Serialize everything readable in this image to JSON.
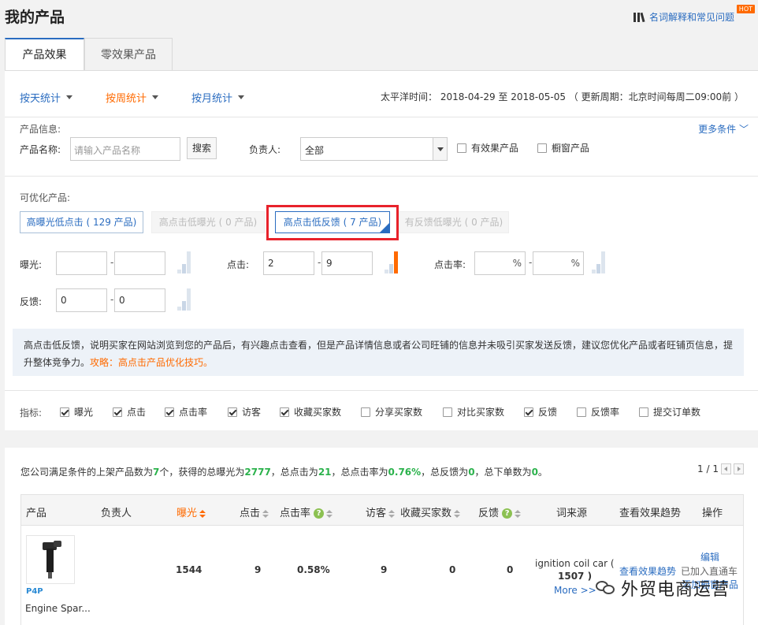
{
  "page_title": "我的产品",
  "help_link": "名词解释和常见问题",
  "hot_badge": "HOT",
  "tabs": [
    "产品效果",
    "零效果产品"
  ],
  "stat_nav": [
    {
      "label": "按天统计",
      "color": "#2a6cc0"
    },
    {
      "label": "按周统计",
      "color": "#ff6a00"
    },
    {
      "label": "按月统计",
      "color": "#2a6cc0"
    }
  ],
  "date_range": "太平洋时间： 2018-04-29 至 2018-05-05 （ 更新周期：北京时间每周二09:00前 ）",
  "filter": {
    "section_label": "产品信息:",
    "name_label": "产品名称:",
    "name_placeholder": "请输入产品名称",
    "search_button": "搜索",
    "owner_label": "负责人:",
    "owner_value": "全部",
    "effective_checkbox": "有效果产品",
    "window_checkbox": "橱窗产品",
    "more_conditions": "更多条件"
  },
  "optimizable": {
    "label": "可优化产品:",
    "buttons": [
      "高曝光低点击 ( 129 产品)",
      "高点击低曝光 ( 0 产品)",
      "高点击低反馈 ( 7 产品)",
      "有反馈低曝光 ( 0 产品)"
    ]
  },
  "ranges": {
    "exposure_label": "曝光:",
    "exposure_min": "",
    "exposure_max": "",
    "click_label": "点击:",
    "click_min": "2",
    "click_max": "9",
    "ctr_label": "点击率:",
    "ctr_min": "",
    "ctr_max": "",
    "pct": "%",
    "feedback_label": "反馈:",
    "feedback_min": "0",
    "feedback_max": "0",
    "dash": "-"
  },
  "info": {
    "text": "高点击低反馈，说明买家在网站浏览到您的产品后，有兴趣点击查看，但是产品详情信息或者公司旺铺的信息并未吸引买家发送反馈，建议您优化产品或者旺铺页信息，提升整体竞争力。",
    "link": "攻略：高点击产品优化技巧。"
  },
  "metrics": {
    "label": "指标:",
    "items": [
      {
        "label": "曝光",
        "checked": true
      },
      {
        "label": "点击",
        "checked": true
      },
      {
        "label": "点击率",
        "checked": true
      },
      {
        "label": "访客",
        "checked": true
      },
      {
        "label": "收藏买家数",
        "checked": true
      },
      {
        "label": "分享买家数",
        "checked": false
      },
      {
        "label": "对比买家数",
        "checked": false
      },
      {
        "label": "反馈",
        "checked": true
      },
      {
        "label": "反馈率",
        "checked": false
      },
      {
        "label": "提交订单数",
        "checked": false
      }
    ]
  },
  "summary": {
    "p1": "您公司满足条件的上架产品数为",
    "products": "7",
    "p2": "个，获得的总曝光为",
    "exposure": "2777",
    "p3": "，总点击为",
    "clicks": "21",
    "p4": "，总点击率为",
    "ctr": "0.76%",
    "p5": "，总反馈为",
    "feedback": "0",
    "p6": "，总下单数为",
    "orders": "0",
    "p7": "。"
  },
  "pager": "1 / 1",
  "table": {
    "headers": [
      "产品",
      "负责人",
      "曝光",
      "点击",
      "点击率",
      "访客",
      "收藏买家数",
      "反馈",
      "词来源",
      "查看效果趋势",
      "操作"
    ],
    "row": {
      "p4p": "P4P",
      "name": "Engine Spar...",
      "exposure": "1544",
      "clicks": "9",
      "ctr": "0.58%",
      "visitors": "9",
      "favorites": "0",
      "feedback": "0",
      "keyword_line1": "ignition coil car (",
      "keyword_line2": "1507 )",
      "keyword_more": "More >>",
      "trend": "查看效果趋势",
      "edit": "编辑",
      "added": "已加入直通车",
      "add_window": "添加橱窗产品"
    }
  },
  "watermark": "外贸电商运营"
}
